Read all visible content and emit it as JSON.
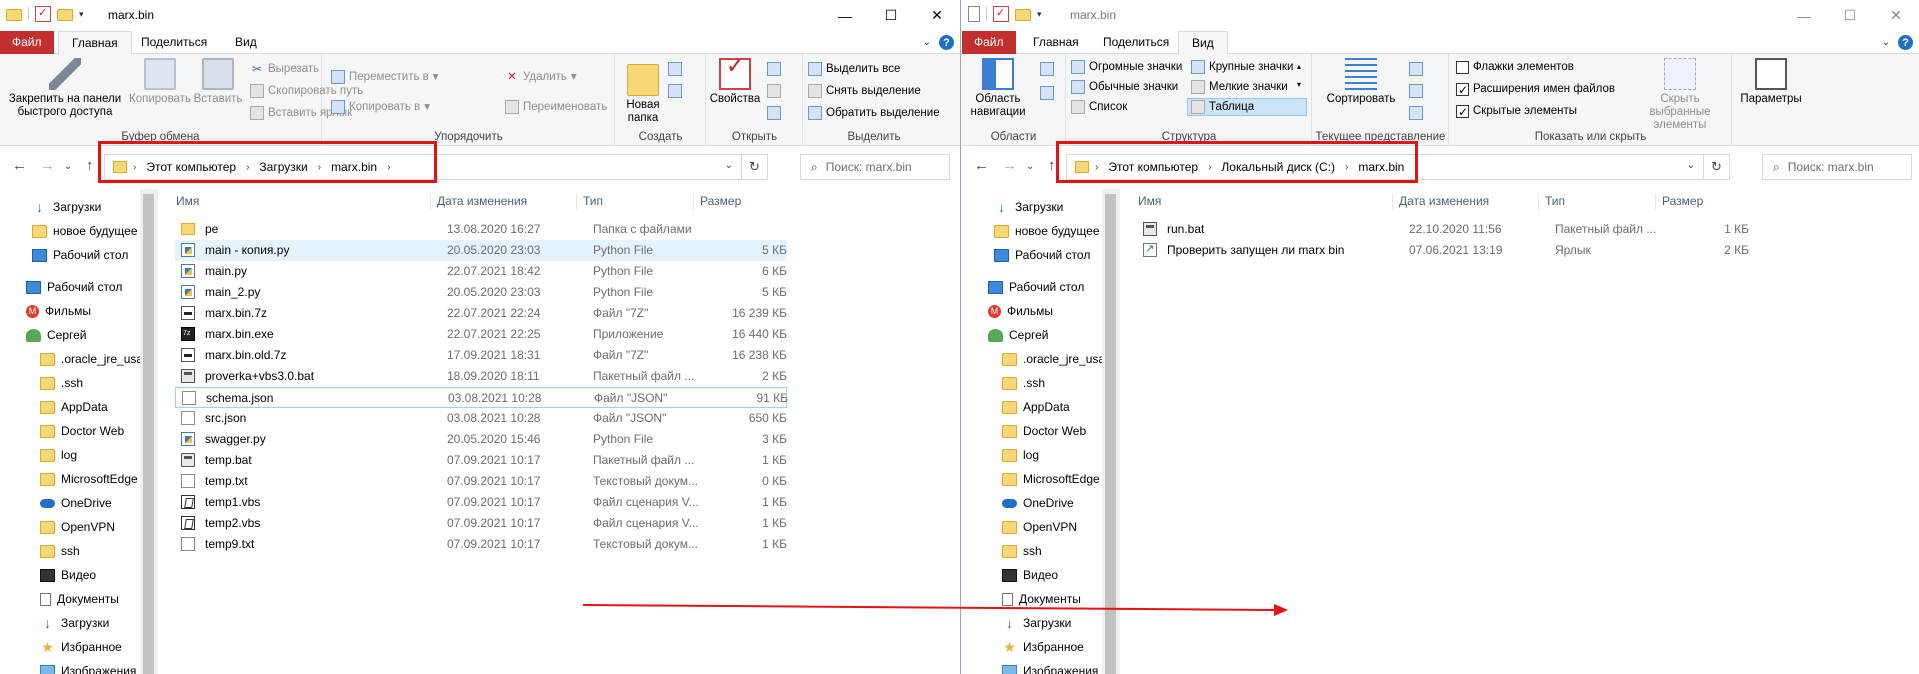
{
  "left_window": {
    "title": "marx.bin",
    "tabs": [
      "Файл",
      "Главная",
      "Поделиться",
      "Вид"
    ],
    "ribbon": {
      "clipboard": {
        "label": "Буфер обмена",
        "pin": "Закрепить на панели быстрого доступа",
        "copy": "Копировать",
        "paste": "Вставить",
        "cut": "Вырезать",
        "copy_path": "Скопировать путь",
        "paste_shortcut": "Вставить ярлык"
      },
      "organize": {
        "label": "Упорядочить",
        "move_to": "Переместить в",
        "copy_to": "Копировать в",
        "delete": "Удалить",
        "rename": "Переименовать"
      },
      "create": {
        "label": "Создать",
        "new_folder": "Новая папка"
      },
      "open": {
        "label": "Открыть",
        "properties": "Свойства"
      },
      "select": {
        "label": "Выделить",
        "select_all": "Выделить все",
        "select_none": "Снять выделение",
        "invert": "Обратить выделение"
      }
    },
    "address": [
      "Этот компьютер",
      "Загрузки",
      "marx.bin"
    ],
    "search_placeholder": "Поиск: marx.bin",
    "columns": [
      "Имя",
      "Дата изменения",
      "Тип",
      "Размер"
    ],
    "files": [
      {
        "name": "pe",
        "date": "13.08.2020 16:27",
        "type": "Папка с файлами",
        "size": "",
        "icon": "folder-icon"
      },
      {
        "name": "main - копия.py",
        "date": "20.05.2020 23:03",
        "type": "Python File",
        "size": "5 КБ",
        "icon": "python-file-icon"
      },
      {
        "name": "main.py",
        "date": "22.07.2021 18:42",
        "type": "Python File",
        "size": "6 КБ",
        "icon": "python-file-icon"
      },
      {
        "name": "main_2.py",
        "date": "20.05.2020 23:03",
        "type": "Python File",
        "size": "5 КБ",
        "icon": "python-file-icon"
      },
      {
        "name": "marx.bin.7z",
        "date": "22.07.2021 22:24",
        "type": "Файл \"7Z\"",
        "size": "16 239 КБ",
        "icon": "archive-icon"
      },
      {
        "name": "marx.bin.exe",
        "date": "22.07.2021 22:25",
        "type": "Приложение",
        "size": "16 440 КБ",
        "icon": "exe-icon"
      },
      {
        "name": "marx.bin.old.7z",
        "date": "17.09.2021 18:31",
        "type": "Файл \"7Z\"",
        "size": "16 238 КБ",
        "icon": "archive-icon"
      },
      {
        "name": "proverka+vbs3.0.bat",
        "date": "18.09.2020 18:11",
        "type": "Пакетный файл ...",
        "size": "2 КБ",
        "icon": "batch-file-icon"
      },
      {
        "name": "schema.json",
        "date": "03.08.2021 10:28",
        "type": "Файл \"JSON\"",
        "size": "91 КБ",
        "icon": "document-icon"
      },
      {
        "name": "src.json",
        "date": "03.08.2021 10:28",
        "type": "Файл \"JSON\"",
        "size": "650 КБ",
        "icon": "document-icon"
      },
      {
        "name": "swagger.py",
        "date": "20.05.2020 15:46",
        "type": "Python File",
        "size": "3 КБ",
        "icon": "python-file-icon"
      },
      {
        "name": "temp.bat",
        "date": "07.09.2021 10:17",
        "type": "Пакетный файл ...",
        "size": "1 КБ",
        "icon": "batch-file-icon"
      },
      {
        "name": "temp.txt",
        "date": "07.09.2021 10:17",
        "type": "Текстовый докум...",
        "size": "0 КБ",
        "icon": "document-icon"
      },
      {
        "name": "temp1.vbs",
        "date": "07.09.2021 10:17",
        "type": "Файл сценария V...",
        "size": "1 КБ",
        "icon": "script-file-icon"
      },
      {
        "name": "temp2.vbs",
        "date": "07.09.2021 10:17",
        "type": "Файл сценария V...",
        "size": "1 КБ",
        "icon": "script-file-icon"
      },
      {
        "name": "temp9.txt",
        "date": "07.09.2021 10:17",
        "type": "Текстовый докум...",
        "size": "1 КБ",
        "icon": "document-icon"
      }
    ]
  },
  "right_window": {
    "title": "marx.bin",
    "tabs": [
      "Файл",
      "Главная",
      "Поделиться",
      "Вид"
    ],
    "ribbon": {
      "panes": {
        "label": "Области",
        "nav_pane": "Область навигации"
      },
      "layout": {
        "label": "Структура",
        "items": [
          "Огромные значки",
          "Крупные значки",
          "Обычные значки",
          "Мелкие значки",
          "Список",
          "Таблица"
        ],
        "selected": "Таблица"
      },
      "current_view": {
        "label": "Текущее представление",
        "sort": "Сортировать"
      },
      "show_hide": {
        "label": "Показать или скрыть",
        "item_checkboxes": "Флажки элементов",
        "file_extensions": "Расширения имен файлов",
        "hidden_items": "Скрытые элементы",
        "hide_selected": "Скрыть выбранные элементы",
        "checks": [
          false,
          true,
          true
        ]
      },
      "options": "Параметры"
    },
    "address": [
      "Этот компьютер",
      "Локальный диск (C:)",
      "marx.bin"
    ],
    "search_placeholder": "Поиск: marx.bin",
    "columns": [
      "Имя",
      "Дата изменения",
      "Тип",
      "Размер"
    ],
    "files": [
      {
        "name": "run.bat",
        "date": "22.10.2020 11:56",
        "type": "Пакетный файл ...",
        "size": "1 КБ",
        "icon": "batch-file-icon"
      },
      {
        "name": "Проверить запущен ли marx bin",
        "date": "07.06.2021 13:19",
        "type": "Ярлык",
        "size": "2 КБ",
        "icon": "shortcut-icon"
      }
    ]
  },
  "nav_pane": [
    {
      "label": "Загрузки",
      "icon": "downloads-icon"
    },
    {
      "label": "новое будущее",
      "icon": "folder-icon"
    },
    {
      "label": "Рабочий стол",
      "icon": "desktop-icon"
    },
    {
      "label": "Рабочий стол",
      "icon": "desktop-icon"
    },
    {
      "label": "Фильмы",
      "icon": "movies-icon"
    },
    {
      "label": "Сергей",
      "icon": "user-icon"
    },
    {
      "label": ".oracle_jre_usag",
      "icon": "folder-icon"
    },
    {
      "label": ".ssh",
      "icon": "folder-icon"
    },
    {
      "label": "AppData",
      "icon": "folder-icon"
    },
    {
      "label": "Doctor Web",
      "icon": "folder-icon"
    },
    {
      "label": "log",
      "icon": "folder-icon"
    },
    {
      "label": "MicrosoftEdge",
      "icon": "folder-icon"
    },
    {
      "label": "OneDrive",
      "icon": "onedrive-icon"
    },
    {
      "label": "OpenVPN",
      "icon": "folder-icon"
    },
    {
      "label": "ssh",
      "icon": "folder-icon"
    },
    {
      "label": "Видео",
      "icon": "video-icon"
    },
    {
      "label": "Документы",
      "icon": "documents-icon"
    },
    {
      "label": "Загрузки",
      "icon": "downloads-icon"
    },
    {
      "label": "Избранное",
      "icon": "favorites-icon"
    },
    {
      "label": "Изображения",
      "icon": "images-icon"
    }
  ],
  "colors": {
    "file_tab": "#c22f2f",
    "highlight_box": "#e41313",
    "selection": "#e5f3ff",
    "accent": "#1f6fc2"
  }
}
